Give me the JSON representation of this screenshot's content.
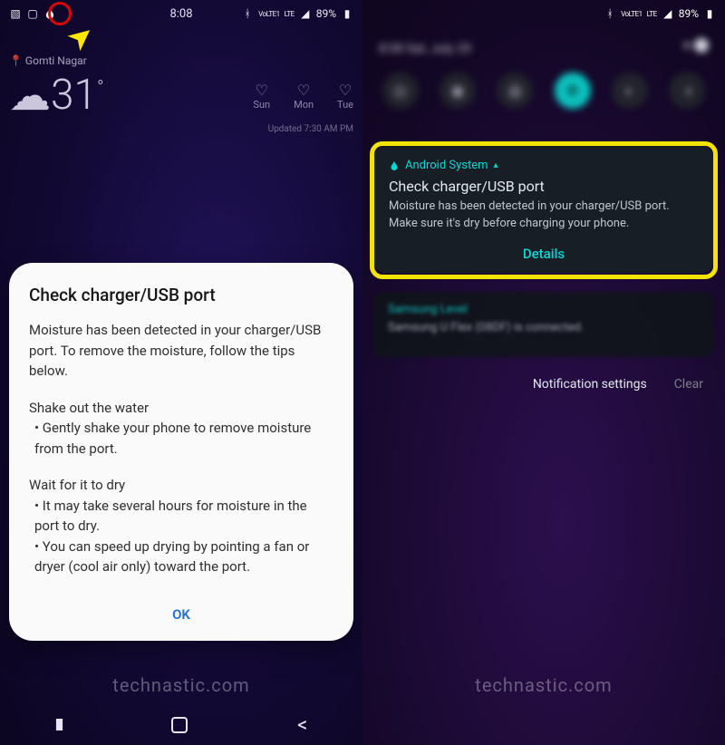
{
  "statusbar": {
    "time": "8:08",
    "battery_pct": "89%",
    "right_labels": [
      "VoLTE1",
      "LTE"
    ]
  },
  "weather": {
    "location": "Gomti Nagar",
    "temp": "31",
    "days": [
      {
        "label": "Sun"
      },
      {
        "label": "Mon"
      },
      {
        "label": "Tue"
      }
    ],
    "updated": "Updated 7:30 AM PM"
  },
  "dialog": {
    "title": "Check charger/USB port",
    "intro": "Moisture has been detected in your charger/USB port. To remove the moisture, follow the tips below.",
    "tip1_head": "Shake out the water",
    "tip1_item1": " • Gently shake your phone to remove moisture from the port.",
    "tip2_head": "Wait for it to dry",
    "tip2_item1": " • It may take several hours for moisture in the port to dry.",
    "tip2_item2": " • You can speed up drying by pointing a fan or dryer (cool air only) toward the port.",
    "ok": "OK"
  },
  "notification": {
    "app": "Android System",
    "title": "Check charger/USB port",
    "body": "Moisture has been detected in your charger/USB port. Make sure it's dry before charging your phone.",
    "action": "Details"
  },
  "notification2": {
    "app": "Samsung Level",
    "body": "Samsung U Flex (08DF) is connected."
  },
  "shade": {
    "date": "8:08  Sat, July 20",
    "settings": "Notification settings",
    "clear": "Clear"
  },
  "watermark": "technastic.com"
}
